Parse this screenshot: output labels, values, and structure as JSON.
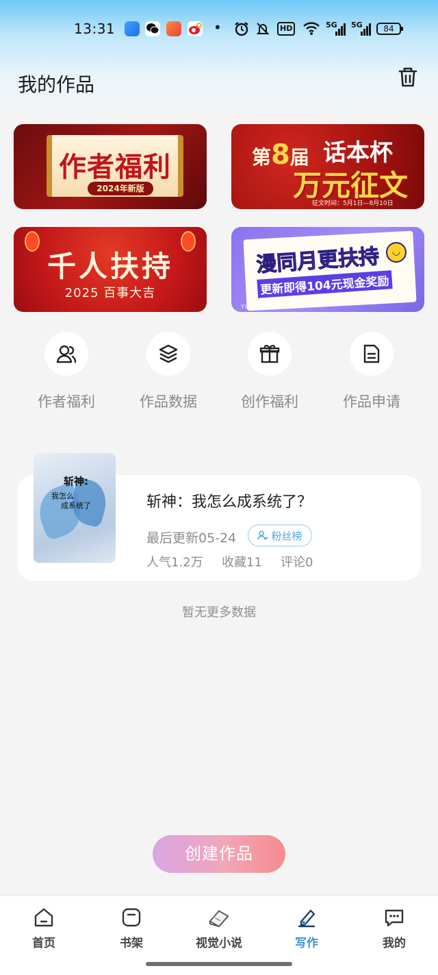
{
  "status_bar": {
    "time": "13:31",
    "hd_label": "HD",
    "signal1_label": "5G",
    "signal2_label": "5G",
    "battery": "84",
    "icons": [
      "browser-app-icon",
      "wechat-icon",
      "game-app-icon",
      "weibo-icon",
      "dot-icon",
      "alarm-icon",
      "mute-icon",
      "hd-icon",
      "wifi-icon",
      "signal-icon",
      "signal-icon",
      "battery-icon"
    ]
  },
  "header": {
    "title": "我的作品",
    "trash_icon": "trash-icon"
  },
  "banners": [
    {
      "big": "作者福利",
      "tag": "2024年新版"
    },
    {
      "prefix": "第",
      "num": "8",
      "suffix": "届",
      "name": "话本杯",
      "headline": "万元征文",
      "period": "征文时间：5月1日—8月10日"
    },
    {
      "big": "千人扶持",
      "sub": "2025 百事大吉"
    },
    {
      "headline": "漫同月更扶持",
      "sub": "更新即得104元现金奖励",
      "footer": "YUEGENGFUCH"
    }
  ],
  "quick_entries": [
    {
      "label": "作者福利",
      "icon": "user-icon"
    },
    {
      "label": "作品数据",
      "icon": "layers-icon"
    },
    {
      "label": "创作福利",
      "icon": "gift-icon"
    },
    {
      "label": "作品申请",
      "icon": "document-icon"
    }
  ],
  "work": {
    "cover_title": "斩神:",
    "cover_line1": "我怎么",
    "cover_line2": "成系统了",
    "title": "斩神：我怎么成系统了？",
    "updated": "最后更新05-24",
    "fans_badge": "粉丝榜",
    "popularity": "人气1.2万",
    "favorites": "收藏11",
    "comments": "评论0"
  },
  "no_more_text": "暂无更多数据",
  "create_button": "创建作品",
  "bottom_nav": {
    "active": "写作",
    "items": [
      {
        "label": "首页",
        "icon": "home-icon"
      },
      {
        "label": "书架",
        "icon": "bookshelf-icon"
      },
      {
        "label": "视觉小说",
        "icon": "book-icon"
      },
      {
        "label": "写作",
        "icon": "write-icon"
      },
      {
        "label": "我的",
        "icon": "chat-icon"
      }
    ]
  },
  "colors": {
    "accent": "#3d8fe0",
    "create_gradient_start": "#d9a6e4",
    "create_gradient_end": "#f58b8e",
    "background": "#f4f4f5"
  }
}
